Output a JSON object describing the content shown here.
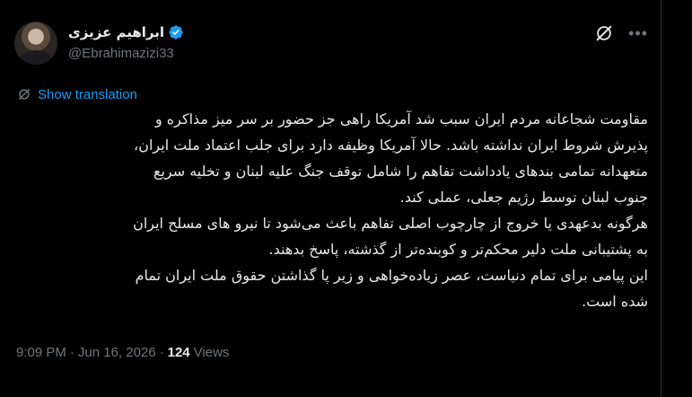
{
  "author": {
    "name": "ابراهیم عزیزی",
    "handle": "@Ebrahimazizi33"
  },
  "translate_label": "Show translation",
  "tweet_lines": [
    "مقاومت شجاعانه مردم ایران سبب شد آمریکا راهی جز حضور بر سر میز مذاکره و",
    "پذیرش شروط ایران نداشته باشد. حالا آمریکا وظیفه دارد برای جلب اعتماد ملت ایران،",
    "متعهدانه تمامی بندهای یادداشت تفاهم را شامل توقف جنگ علیه لبنان و تخلیه سریع",
    "جنوب لبنان توسط رژیم جعلی، عملی کند.",
    "هرگونه بدعهدی یا خروج از چارچوب اصلی تفاهم باعث می‌شود تا نیرو های مسلح ایران",
    "به پشتیبانی ملت دلیر محکم‌تر و کوبنده‌تر از گذشته، پاسخ بدهند.",
    "این پیامی برای تمام دنیاست، عصر زیاده‌خواهی و زیر پا گذاشتن حقوق ملت ایران تمام",
    "شده است."
  ],
  "meta": {
    "time": "9:09 PM",
    "separator": "·",
    "date": "Jun 16, 2026",
    "views_count": "124",
    "views_label": "Views"
  },
  "icons": {
    "verified": "verified-badge-icon",
    "grok": "grok-icon",
    "more": "more-icon",
    "translate": "translate-icon"
  },
  "colors": {
    "background": "#000000",
    "text": "#e7e9ea",
    "muted": "#71767b",
    "accent": "#1d9bf0"
  }
}
